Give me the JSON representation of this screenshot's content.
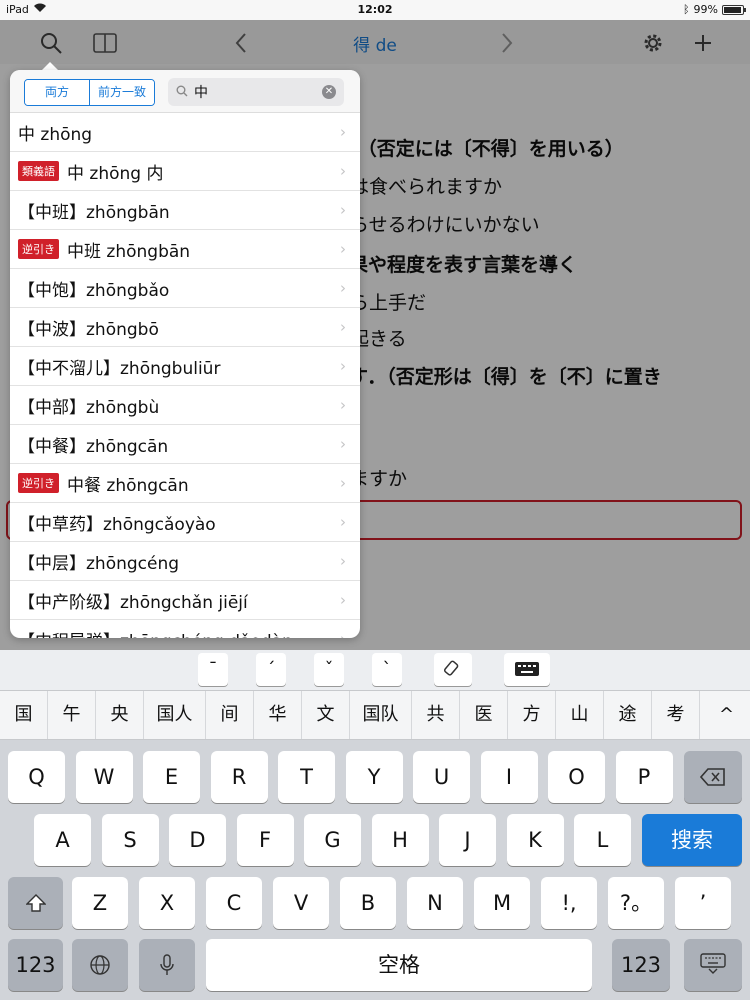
{
  "status": {
    "device": "iPad",
    "time": "12:02",
    "battery": "99%"
  },
  "nav": {
    "title": "得 de"
  },
  "content": {
    "lines": [
      "す．（否定には〔不得〕を用いる）",
      "は食べられますか",
      "らせるわけにいかない",
      "結果や程度を表す言葉を導く",
      "ら上手だ",
      "起きる",
      "示す．（否定形は〔得〕を〔不〕に置き",
      "ますか"
    ]
  },
  "popover": {
    "seg_both": "両方",
    "seg_prefix": "前方一致",
    "search_value": "中",
    "rows": [
      {
        "badge": "",
        "text": "中 zhōng"
      },
      {
        "badge": "類義語",
        "text": "中 zhōng 内"
      },
      {
        "badge": "",
        "text": "【中班】zhōngbān"
      },
      {
        "badge": "逆引き",
        "text": "中班 zhōngbān"
      },
      {
        "badge": "",
        "text": "【中饱】zhōngbǎo"
      },
      {
        "badge": "",
        "text": "【中波】zhōngbō"
      },
      {
        "badge": "",
        "text": "【中不溜儿】zhōngbuliūr"
      },
      {
        "badge": "",
        "text": "【中部】zhōngbù"
      },
      {
        "badge": "",
        "text": "【中餐】zhōngcān"
      },
      {
        "badge": "逆引き",
        "text": "中餐 zhōngcān"
      },
      {
        "badge": "",
        "text": "【中草药】zhōngcǎoyào"
      },
      {
        "badge": "",
        "text": "【中层】zhōngcéng"
      },
      {
        "badge": "",
        "text": "【中产阶级】zhōngchǎn jiējí"
      },
      {
        "badge": "",
        "text": "【中程导弹】zhōngchéng dǎodàn"
      }
    ]
  },
  "keyboard": {
    "tones": [
      "ˉ",
      "ˊ",
      "ˇ",
      "ˋ"
    ],
    "candidates": [
      "国",
      "午",
      "央",
      "国人",
      "间",
      "华",
      "文",
      "国队",
      "共",
      "医",
      "方",
      "山",
      "途",
      "考",
      "^"
    ],
    "row1": [
      "Q",
      "W",
      "E",
      "R",
      "T",
      "Y",
      "U",
      "I",
      "O",
      "P"
    ],
    "row2": [
      "A",
      "S",
      "D",
      "F",
      "G",
      "H",
      "J",
      "K",
      "L"
    ],
    "row3": [
      "Z",
      "X",
      "C",
      "V",
      "B",
      "N",
      "M",
      "!,",
      "?。",
      "’"
    ],
    "search_key": "搜索",
    "space": "空格",
    "num_key": "123"
  }
}
